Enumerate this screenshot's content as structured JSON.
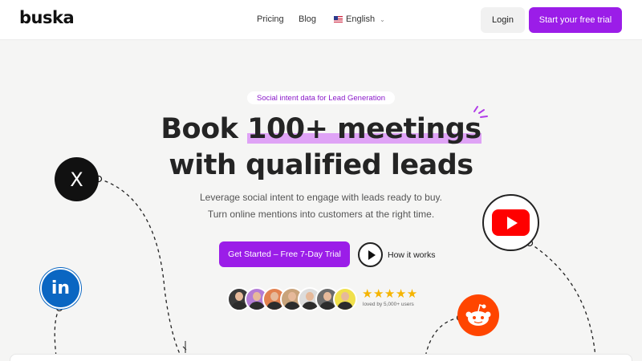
{
  "header": {
    "logo": "buska",
    "nav": {
      "pricing": "Pricing",
      "blog": "Blog",
      "language": "English"
    },
    "login": "Login",
    "trial": "Start your free trial"
  },
  "hero": {
    "badge": "Social intent data for Lead Generation",
    "title_line1_prefix": "Book ",
    "title_line1_highlight": "100+ meetings",
    "title_line2": "with qualified leads",
    "subtitle_line1": "Leverage social intent to engage with leads ready to buy.",
    "subtitle_line2": "Turn online mentions into customers at the right time.",
    "cta": "Get Started – Free 7-Day Trial",
    "how": "How it works",
    "stars": "★★★★★",
    "loved": "loved by 5,000+ users"
  },
  "social": {
    "x": "X",
    "linkedin": "in"
  },
  "colors": {
    "accent": "#9b1de8",
    "highlight": "#dfa3f6",
    "star": "#f5b400",
    "linkedin": "#0a66c2",
    "youtube": "#ff0000",
    "reddit": "#ff4500"
  },
  "avatar_colors": [
    "#3a3a3a",
    "#b47cd6",
    "#e2814f",
    "#c9a37a",
    "#2f2f2f",
    "#6b6b6b",
    "#f0e04c"
  ]
}
